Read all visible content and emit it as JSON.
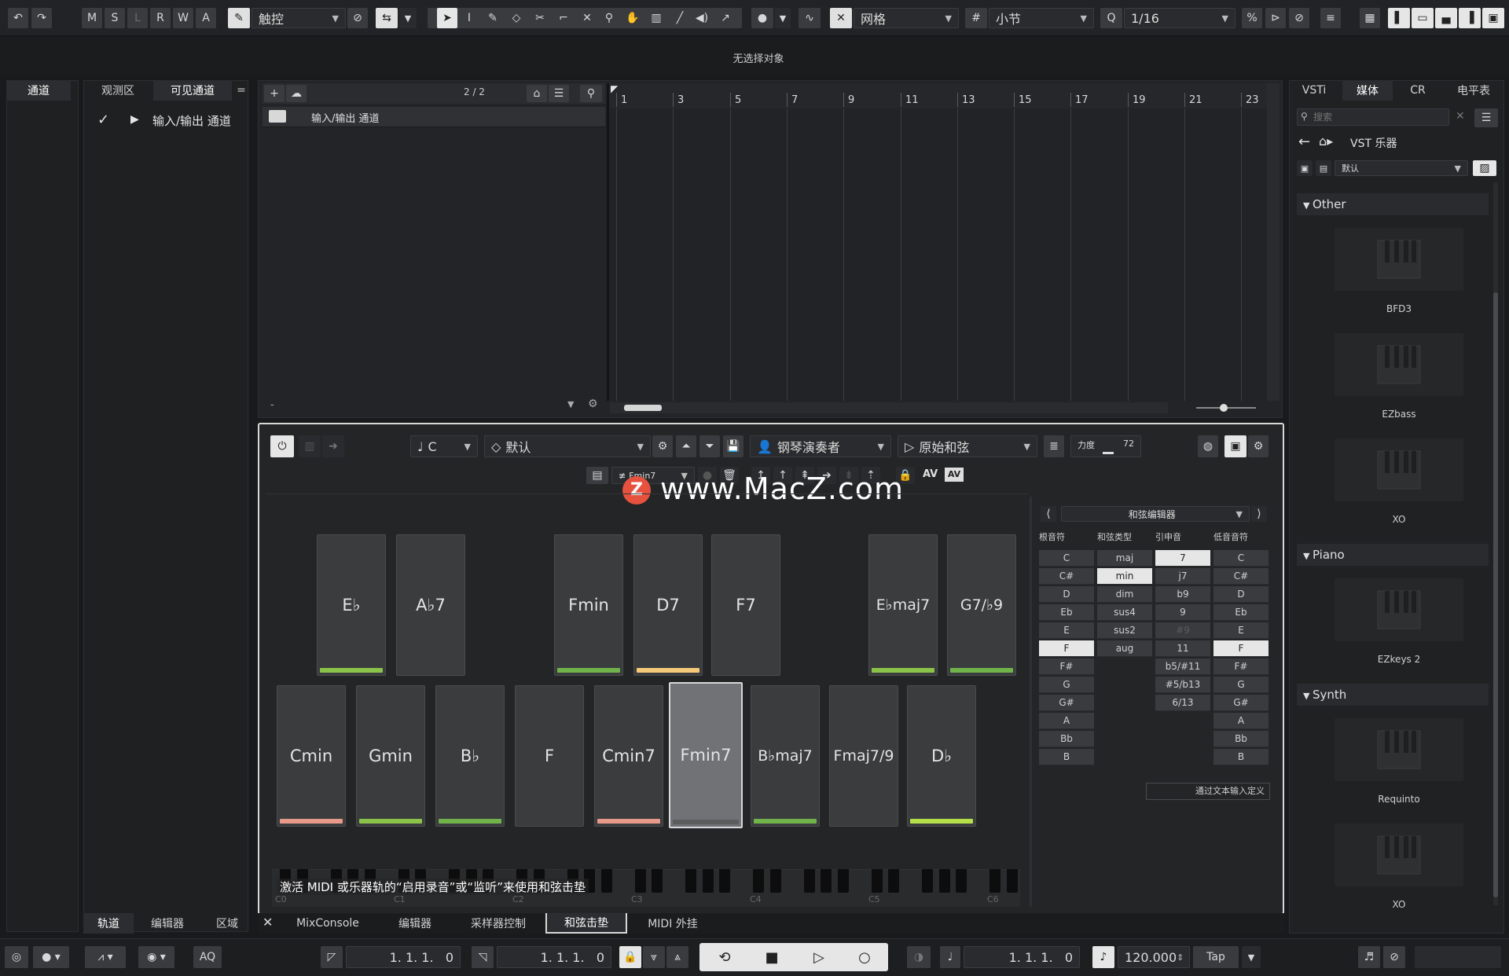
{
  "toolbar": {
    "msrwa": [
      "M",
      "S",
      "L",
      "R",
      "W",
      "A"
    ],
    "automation_mode": "触控",
    "grid_type": "网格",
    "grid_value": "小节",
    "quantize": "1/16"
  },
  "status_line": "无选择对象",
  "left_zone": {
    "tab": "通道",
    "inspector_tabs": [
      "观测区",
      "可见通道"
    ],
    "visible_item": "输入/输出 通道",
    "bottom_tabs": [
      "轨道",
      "编辑器",
      "区域"
    ]
  },
  "project": {
    "counter": "2 / 2",
    "track_name": "输入/输出 通道",
    "ruler": [
      "1",
      "3",
      "5",
      "7",
      "9",
      "11",
      "13",
      "15",
      "17",
      "19",
      "21",
      "23"
    ],
    "footer_dash": "-"
  },
  "chord_pads": {
    "key": "C",
    "preset": "默认",
    "player": "钢琴演奏者",
    "voicing": "原始和弦",
    "velocity_label": "力度",
    "velocity": "72",
    "current_chord": "Fmin7",
    "av_label": "AV",
    "av_box": "AV",
    "row1": [
      {
        "label": "E♭",
        "bar": "#8bc34a"
      },
      {
        "label": "A♭7",
        "bar": "#3a3c3e"
      },
      {
        "label": "Fmin",
        "bar": "#6fb34a"
      },
      {
        "label": "D7",
        "bar": "#f5c97a"
      },
      {
        "label": "F7",
        "bar": "#3a3c3e"
      },
      {
        "label": "E♭maj7",
        "bar": "#8bc34a"
      },
      {
        "label": "G7/♭9",
        "bar": "#6fb34a"
      }
    ],
    "row2": [
      {
        "label": "Cmin",
        "bar": "#e89a8a"
      },
      {
        "label": "Gmin",
        "bar": "#8bc34a"
      },
      {
        "label": "B♭",
        "bar": "#6fb34a"
      },
      {
        "label": "F",
        "bar": "#3a3c3e"
      },
      {
        "label": "Cmin7",
        "bar": "#e89a8a"
      },
      {
        "label": "Fmin7",
        "bar": "#3a3c3e"
      },
      {
        "label": "B♭maj7",
        "bar": "#6fb34a"
      },
      {
        "label": "Fmaj7/9",
        "bar": "#3a3c3e"
      },
      {
        "label": "D♭",
        "bar": "#b5e04a"
      }
    ],
    "hint": "激活 MIDI 或乐器轨的“启用录音”或“监听”来使用和弦击垫",
    "octaves": [
      "C0",
      "C1",
      "C2",
      "C3",
      "C4",
      "C5",
      "C6"
    ],
    "watermark": "www.MacZ.com"
  },
  "chord_editor": {
    "title": "和弦编辑器",
    "headers": [
      "根音符",
      "和弦类型",
      "引申音",
      "低音音符"
    ],
    "roots": [
      "C",
      "C#",
      "D",
      "Eb",
      "E",
      "F",
      "F#",
      "G",
      "G#",
      "A",
      "Bb",
      "B"
    ],
    "types": [
      "maj",
      "min",
      "dim",
      "sus4",
      "sus2",
      "aug"
    ],
    "tensions": [
      "7",
      "j7",
      "b9",
      "9",
      "#9",
      "11",
      "b5/#11",
      "#5/b13",
      "6/13"
    ],
    "bass": [
      "C",
      "C#",
      "D",
      "Eb",
      "E",
      "F",
      "F#",
      "G",
      "G#",
      "A",
      "Bb",
      "B"
    ],
    "text_input": "通过文本输入定义"
  },
  "right_zone": {
    "tabs": [
      "VSTi",
      "媒体",
      "CR",
      "电平表"
    ],
    "search_placeholder": "搜索",
    "path": "VST 乐器",
    "filter": "默认",
    "groups": [
      {
        "name": "Other",
        "items": [
          "BFD3",
          "EZbass",
          "XO"
        ]
      },
      {
        "name": "Piano",
        "items": [
          "EZkeys 2"
        ]
      },
      {
        "name": "Synth",
        "items": [
          "Requinto",
          "XO"
        ]
      }
    ]
  },
  "lower_tabs": [
    "MixConsole",
    "编辑器",
    "采样器控制",
    "和弦击垫",
    "MIDI 外挂"
  ],
  "transport": {
    "aq": "AQ",
    "left_locator": "1. 1. 1.   0",
    "right_locator": "1. 1. 1.   0",
    "position": "1. 1. 1.   0",
    "tempo": "120.000",
    "tap": "Tap"
  }
}
